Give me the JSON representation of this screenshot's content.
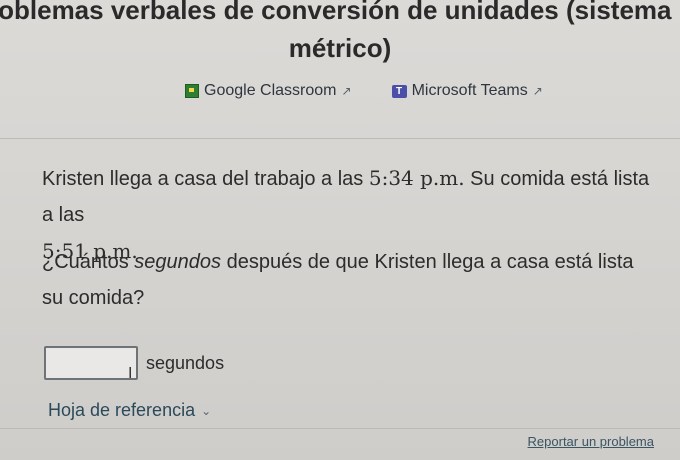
{
  "page": {
    "title_line1": "roblemas verbales de conversión de unidades (sistema",
    "title_line2": "métrico)"
  },
  "share": {
    "google_classroom": "Google Classroom",
    "microsoft_teams": "Microsoft Teams"
  },
  "problem": {
    "text_a": "Kristen llega a casa del trabajo a las ",
    "time1": "5:34 p.m.",
    "text_b": " Su comida está lista a las",
    "time2": "5:51 p.m."
  },
  "question": {
    "text_a": "¿Cuántos ",
    "emphasis": "segundos",
    "text_b": " después de que Kristen llega a casa está lista su comida?"
  },
  "answer": {
    "value": "",
    "unit": "segundos"
  },
  "reference": {
    "label": "Hoja de referencia"
  },
  "footer": {
    "report_label": "Reportar un problema"
  }
}
